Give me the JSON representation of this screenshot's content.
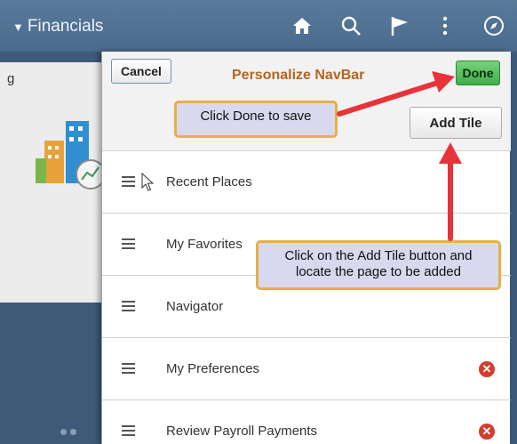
{
  "app_header": {
    "title": "Financials",
    "icons": [
      "home-icon",
      "search-icon",
      "flag-icon",
      "more-vertical-icon",
      "compass-icon"
    ]
  },
  "background": {
    "card_label": "g"
  },
  "panel": {
    "title": "Personalize NavBar",
    "cancel_label": "Cancel",
    "done_label": "Done",
    "add_tile_label": "Add Tile",
    "items": [
      {
        "label": "Recent Places",
        "removable": false
      },
      {
        "label": "My Favorites",
        "removable": false
      },
      {
        "label": "Navigator",
        "removable": false
      },
      {
        "label": "My Preferences",
        "removable": true
      },
      {
        "label": "Review Payroll Payments",
        "removable": true
      }
    ]
  },
  "callouts": {
    "done": "Click Done to save",
    "add_tile_line1": "Click on the Add Tile button and",
    "add_tile_line2": "locate the page to be added"
  },
  "colors": {
    "header": "#4b6b8d",
    "panel_title": "#b5651d",
    "done_button": "#3fae49",
    "callout_border": "#e8b046",
    "callout_fill": "#d8d8ef",
    "arrow": "#e8333a",
    "remove_icon": "#d43c2e"
  }
}
